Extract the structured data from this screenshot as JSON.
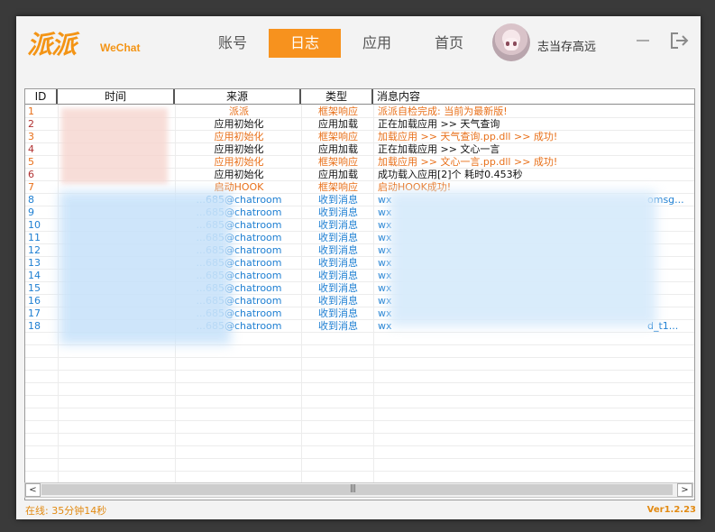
{
  "app": {
    "logo_text": "派派",
    "logo_sub": "WeChat",
    "username": "志当存高远"
  },
  "nav": {
    "tabs": [
      {
        "label": "账号",
        "active": false
      },
      {
        "label": "日志",
        "active": true
      },
      {
        "label": "应用",
        "active": false
      },
      {
        "label": "首页",
        "active": false
      }
    ]
  },
  "table": {
    "columns": [
      "ID",
      "时间",
      "来源",
      "类型",
      "消息内容"
    ],
    "rows": [
      {
        "id": "1",
        "time": "",
        "source": "派派",
        "type": "框架响应",
        "message": "派派自检完成: 当前为最新版!",
        "color": "#e8701a"
      },
      {
        "id": "2",
        "time": "",
        "source": "应用初始化",
        "type": "应用加载",
        "message": "正在加载应用 >> 天气查询",
        "color": "#111111"
      },
      {
        "id": "3",
        "time": "",
        "source": "应用初始化",
        "type": "框架响应",
        "message": "加载应用 >> 天气查询.pp.dll >> 成功!",
        "color": "#e8701a"
      },
      {
        "id": "4",
        "time": "",
        "source": "应用初始化",
        "type": "应用加载",
        "message": "正在加载应用 >> 文心一言",
        "color": "#111111"
      },
      {
        "id": "5",
        "time": "",
        "source": "应用初始化",
        "type": "框架响应",
        "message": "加载应用 >> 文心一言.pp.dll >> 成功!",
        "color": "#e8701a"
      },
      {
        "id": "6",
        "time": "",
        "source": "应用初始化",
        "type": "应用加载",
        "message": "成功载入应用[2]个  耗时0.453秒",
        "color": "#111111"
      },
      {
        "id": "7",
        "time": "",
        "source": "启动HOOK",
        "type": "框架响应",
        "message": "启动HOOK成功!",
        "color": "#e8701a"
      },
      {
        "id": "8",
        "time": "",
        "source": "...685@chatroom",
        "type": "收到消息",
        "message": "wx",
        "message_tail": "omsg...",
        "color": "#1e7fd2"
      },
      {
        "id": "9",
        "time": "",
        "source": "...685@chatroom",
        "type": "收到消息",
        "message": "wx",
        "color": "#1e7fd2"
      },
      {
        "id": "10",
        "time": "",
        "source": "...685@chatroom",
        "type": "收到消息",
        "message": "wx",
        "color": "#1e7fd2"
      },
      {
        "id": "11",
        "time": "",
        "source": "...685@chatroom",
        "type": "收到消息",
        "message": "wx",
        "color": "#1e7fd2"
      },
      {
        "id": "12",
        "time": "",
        "source": "...685@chatroom",
        "type": "收到消息",
        "message": "wx",
        "color": "#1e7fd2"
      },
      {
        "id": "13",
        "time": "",
        "source": "...685@chatroom",
        "type": "收到消息",
        "message": "wx",
        "color": "#1e7fd2"
      },
      {
        "id": "14",
        "time": "",
        "source": "...685@chatroom",
        "type": "收到消息",
        "message": "wx",
        "color": "#1e7fd2"
      },
      {
        "id": "15",
        "time": "",
        "source": "...685@chatroom",
        "type": "收到消息",
        "message": "wx",
        "color": "#1e7fd2"
      },
      {
        "id": "16",
        "time": "",
        "source": "...685@chatroom",
        "type": "收到消息",
        "message": "wx",
        "color": "#1e7fd2"
      },
      {
        "id": "17",
        "time": "",
        "source": "...685@chatroom",
        "type": "收到消息",
        "message": "wx",
        "color": "#1e7fd2"
      },
      {
        "id": "18",
        "time": "",
        "source": "...685@chatroom",
        "type": "收到消息",
        "message": "wx",
        "message_tail": "d_t1...",
        "color": "#1e7fd2"
      }
    ],
    "id_color": "#b03030"
  },
  "scrollbar": {
    "left_arrow": "<",
    "right_arrow": ">",
    "grip": "|||"
  },
  "footer": {
    "status": "在线: 35分钟14秒",
    "version": "Ver1.2.23"
  },
  "colors": {
    "accent": "#f7921e"
  },
  "icons": {
    "minimize": "minimize-icon",
    "exit": "logout-icon",
    "avatar": "avatar"
  }
}
